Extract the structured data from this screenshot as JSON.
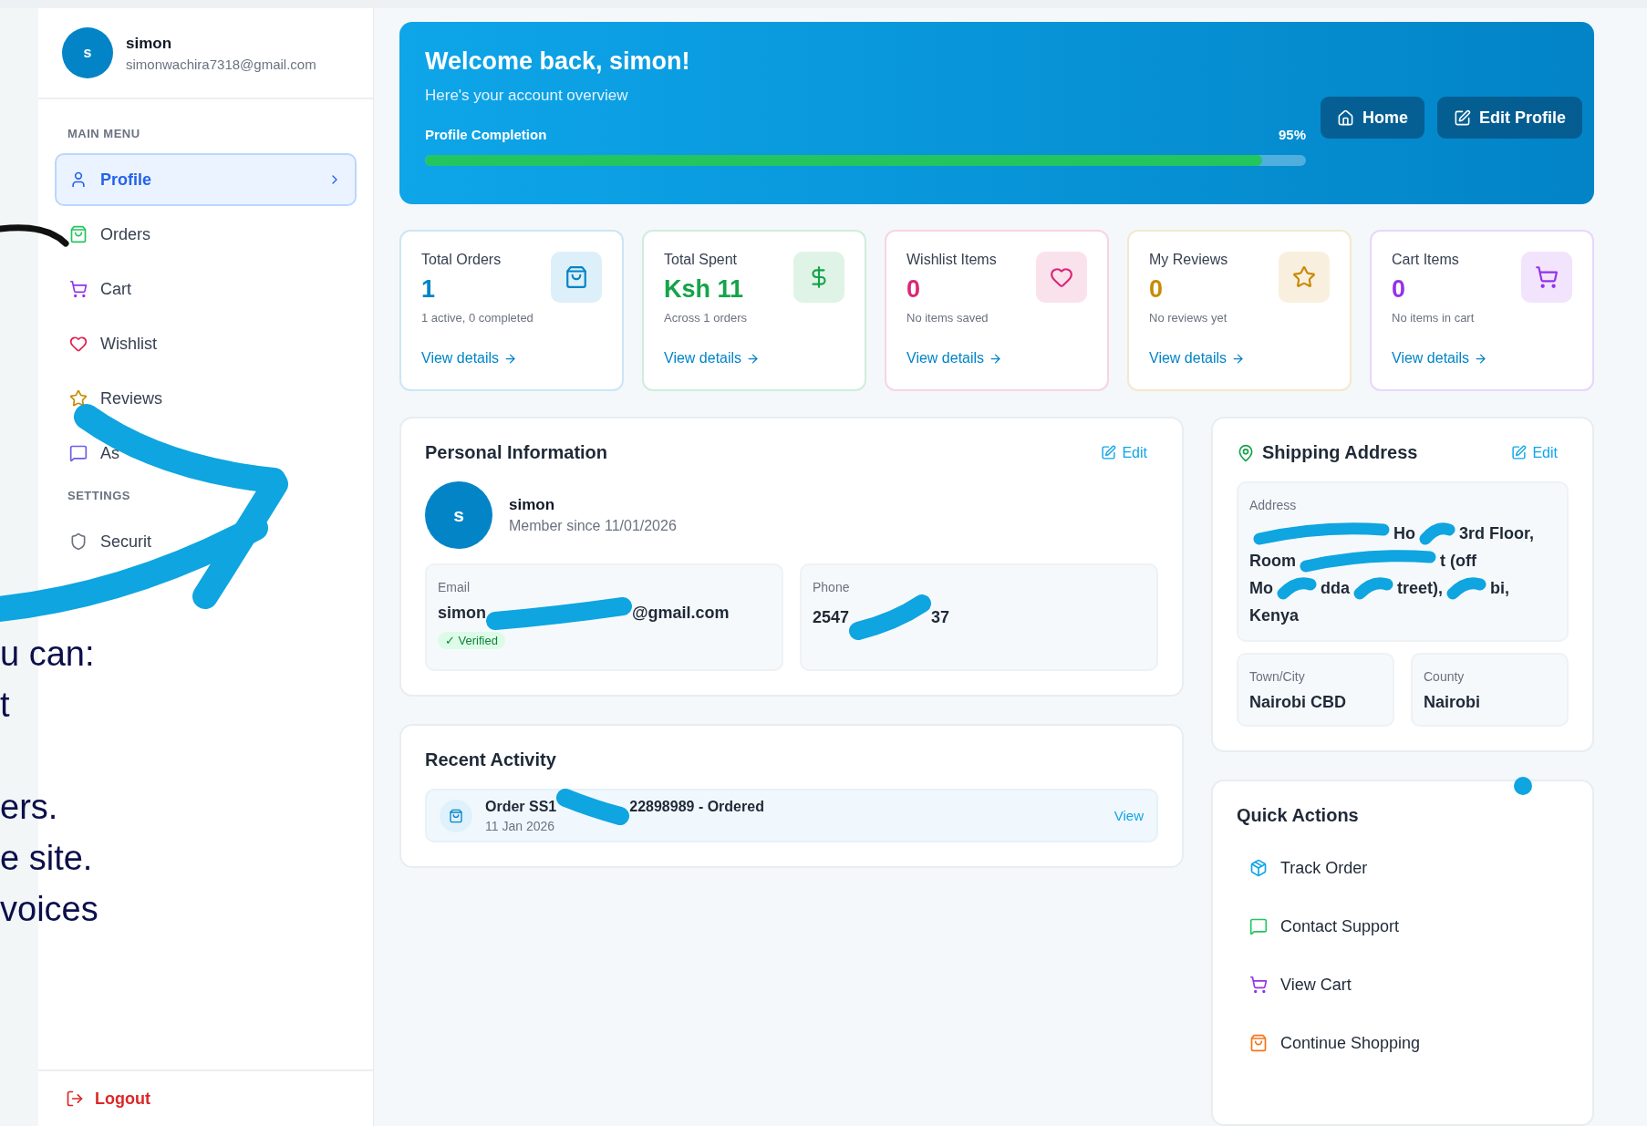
{
  "user": {
    "avatar": "s",
    "name": "simon",
    "email": "simonwachira7318@gmail.com"
  },
  "sidebar": {
    "section": "MAIN MENU",
    "items": [
      {
        "label": "Profile",
        "kind": "user",
        "selected": true
      },
      {
        "label": "Orders",
        "kind": "bag",
        "selected": false
      },
      {
        "label": "Cart",
        "kind": "cart",
        "selected": false
      },
      {
        "label": "Wishlist",
        "kind": "heart",
        "selected": false
      },
      {
        "label": "Reviews",
        "kind": "star",
        "selected": false
      },
      {
        "label": "As",
        "kind": "chat",
        "selected": false
      }
    ],
    "settings_section": "SETTINGS",
    "settings_items": [
      {
        "label": "Securit",
        "kind": "shield",
        "selected": false
      }
    ],
    "logout": "Logout"
  },
  "overlay_text": [
    "u can:",
    "t",
    "ers.",
    "e site.",
    "voices"
  ],
  "hero": {
    "title": "Welcome back, simon!",
    "subtitle": "Here's your account overview",
    "progress_label": "Profile Completion",
    "progress_value": "95%",
    "level": 0.95,
    "buttons": [
      {
        "label": "Home",
        "kind": "home"
      },
      {
        "label": "Edit Profile",
        "kind": "edit"
      }
    ]
  },
  "stats": [
    {
      "title": "Total Orders",
      "value": "1",
      "note": "1 active, 0 completed",
      "link": "View details",
      "kind": "bag",
      "color": "#0284c7"
    },
    {
      "title": "Total Spent",
      "value": "Ksh 11",
      "note": "Across 1 orders",
      "link": "View details",
      "kind": "dollar",
      "color": "#16a34a"
    },
    {
      "title": "Wishlist Items",
      "value": "0",
      "note": "No items saved",
      "link": "View details",
      "kind": "heart",
      "color": "#db2777"
    },
    {
      "title": "My Reviews",
      "value": "0",
      "note": "No reviews yet",
      "link": "View details",
      "kind": "star",
      "color": "#ca8a04"
    },
    {
      "title": "Cart Items",
      "value": "0",
      "note": "No items in cart",
      "link": "View details",
      "kind": "cart",
      "color": "#9333ea"
    }
  ],
  "personal": {
    "title": "Personal Information",
    "edit": "Edit",
    "avatar": "s",
    "name": "simon",
    "member_since": "Member since 11/01/2026",
    "email": {
      "label": "Email",
      "parts": [
        "simon",
        "@gmail.com"
      ],
      "badge": "✓ Verified"
    },
    "phone": {
      "label": "Phone",
      "parts": [
        "2547",
        "37"
      ]
    }
  },
  "activity": {
    "title": "Recent Activity",
    "items": [
      {
        "parts": [
          "Order SS1",
          "22898989 - Ordered"
        ],
        "date": "11 Jan 2026",
        "action": "View"
      }
    ]
  },
  "shipping": {
    "title": "Shipping Address",
    "edit": "Edit",
    "address_label": "Address",
    "address_lines": [
      [
        "Ho",
        "3rd Floor,"
      ],
      [
        "Room",
        "t (off"
      ],
      [
        "Mo",
        "dda",
        "treet),",
        "bi,"
      ],
      [
        "Kenya"
      ]
    ],
    "town_label": "Town/City",
    "town": "Nairobi CBD",
    "county_label": "County",
    "county": "Nairobi"
  },
  "quick_actions": {
    "title": "Quick Actions",
    "items": [
      {
        "label": "Track Order",
        "kind": "package"
      },
      {
        "label": "Contact Support",
        "kind": "chat"
      },
      {
        "label": "View Cart",
        "kind": "cart"
      },
      {
        "label": "Continue Shopping",
        "kind": "bag"
      }
    ]
  }
}
